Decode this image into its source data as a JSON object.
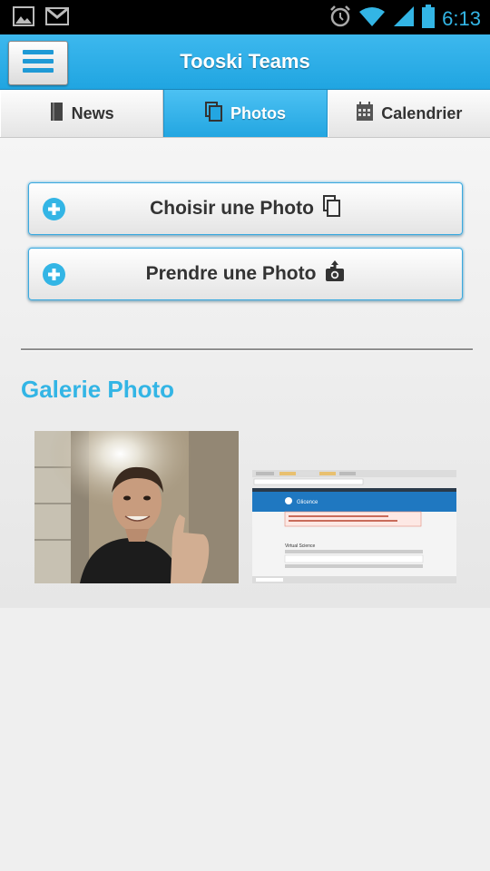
{
  "status_bar": {
    "time": "6:13",
    "icons": [
      "image-icon",
      "gmail-icon",
      "alarm-icon",
      "wifi-icon",
      "signal-icon",
      "battery-icon"
    ]
  },
  "header": {
    "title": "Tooski Teams",
    "menu_icon": "hamburger-menu-icon"
  },
  "tabs": [
    {
      "label": "News",
      "icon": "book-icon",
      "active": false
    },
    {
      "label": "Photos",
      "icon": "photos-icon",
      "active": true
    },
    {
      "label": "Calendrier",
      "icon": "calendar-icon",
      "active": false
    }
  ],
  "actions": [
    {
      "label": "Choisir une Photo",
      "icon": "copy-photos-icon"
    },
    {
      "label": "Prendre une Photo",
      "icon": "camera-icon"
    }
  ],
  "gallery": {
    "title": "Galerie Photo",
    "items": [
      "webcam-selfie-thumbnail",
      "browser-screenshot-thumbnail"
    ],
    "screenshot_thumb": {
      "site": "Glicence",
      "section": "Virtual Science"
    }
  },
  "colors": {
    "accent": "#33b5e5",
    "header": "#20a5e1",
    "button_border": "#3aa9df"
  }
}
